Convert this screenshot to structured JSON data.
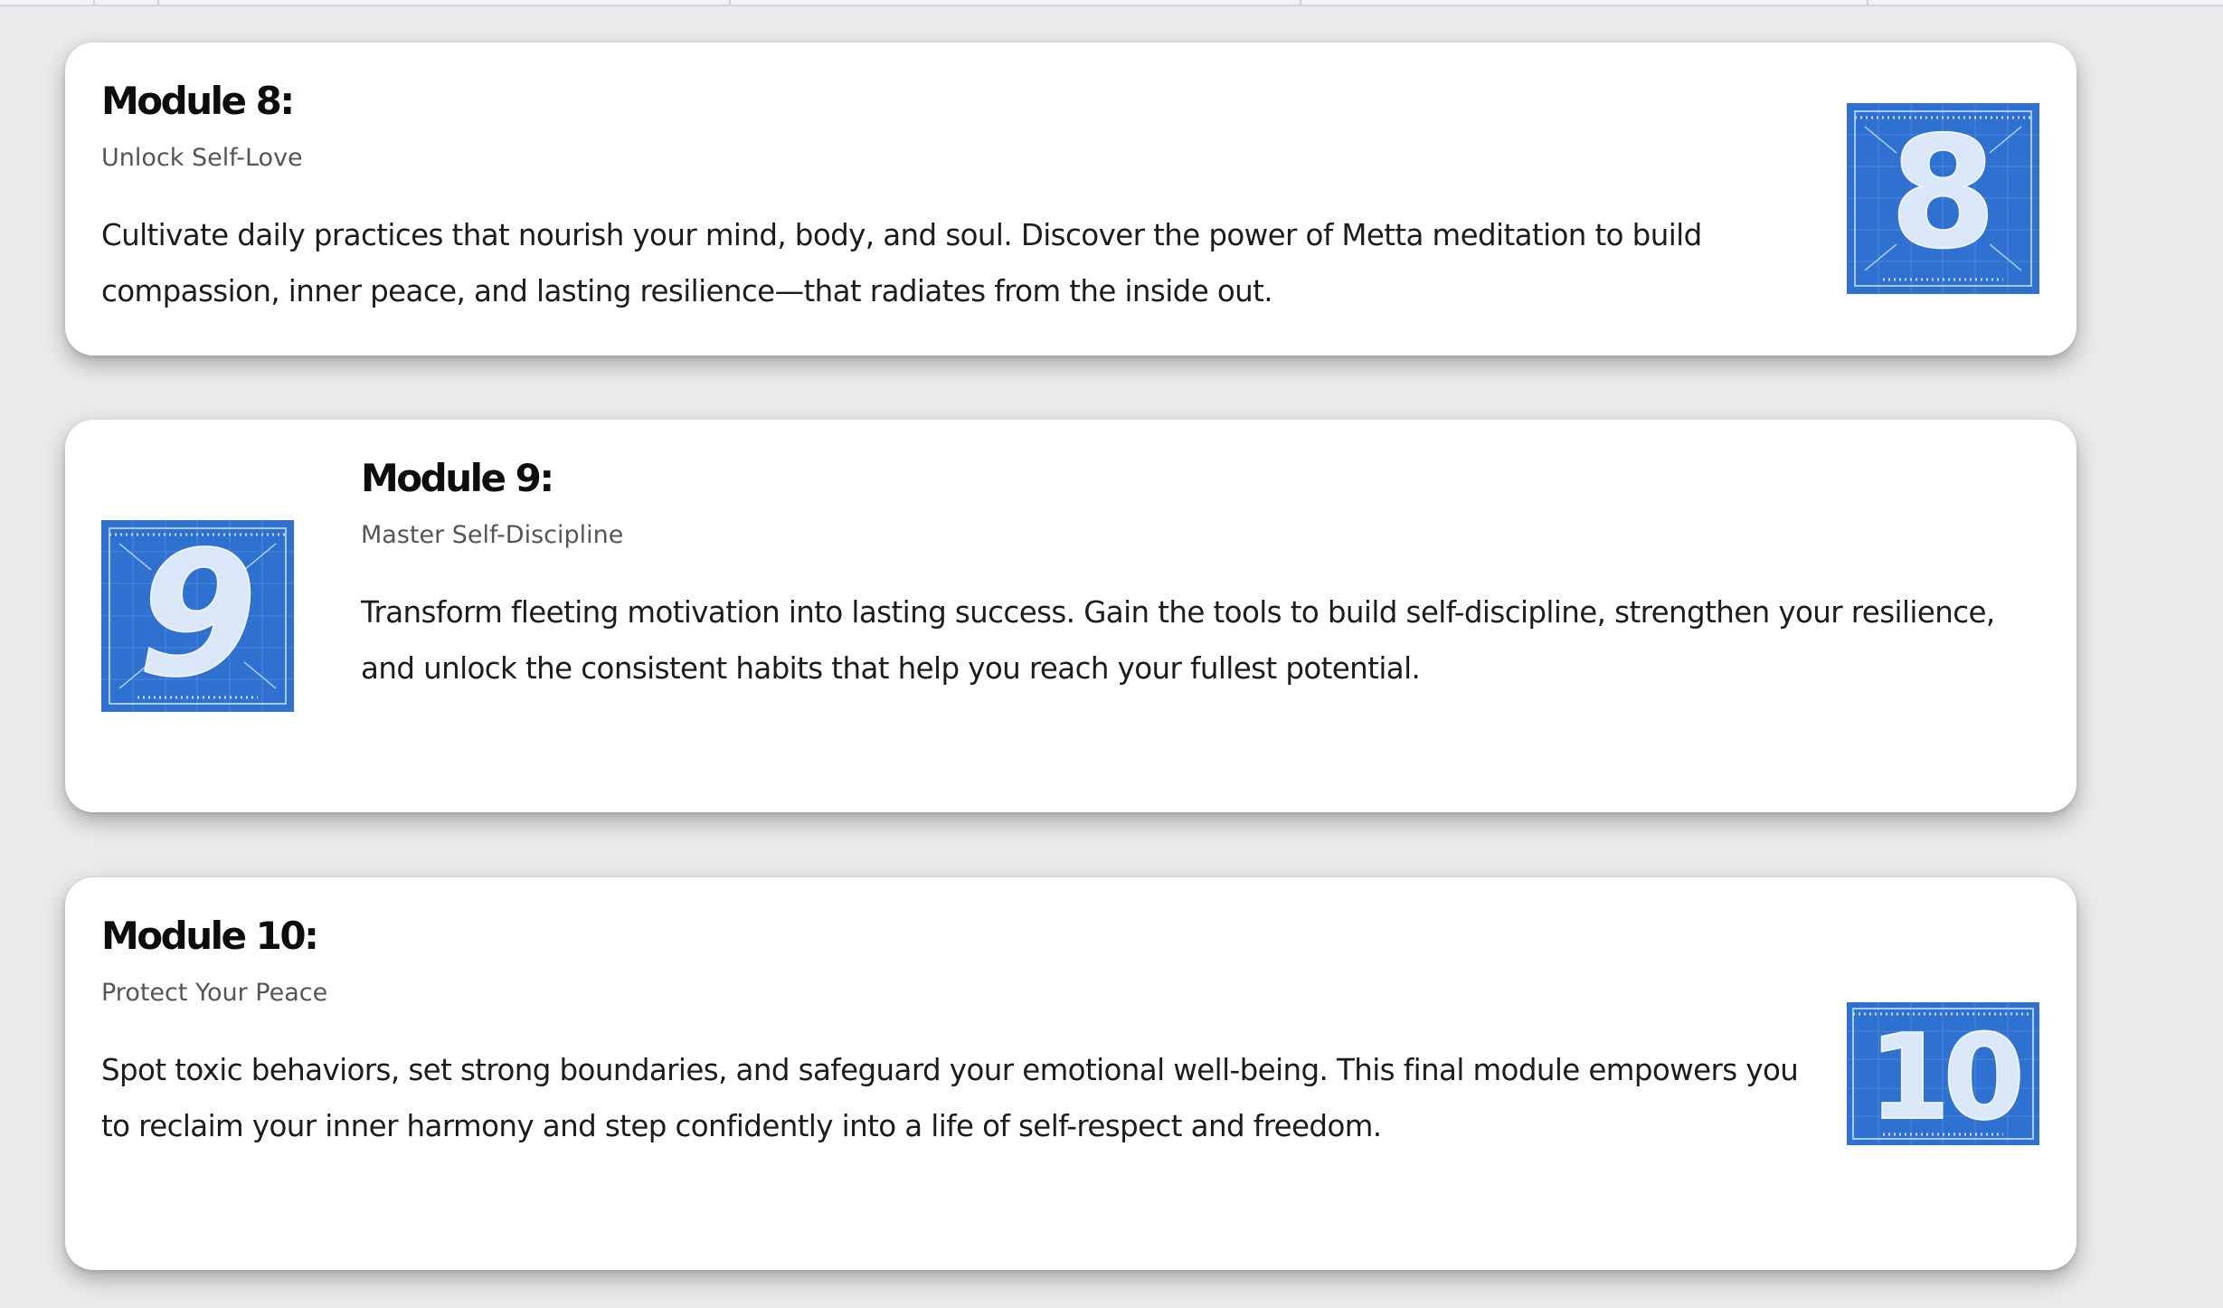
{
  "modules": [
    {
      "title": "Module 8:",
      "subtitle": "Unlock Self-Love",
      "description": "Cultivate daily practices that nourish your mind, body, and soul. Discover the power of Metta meditation to build compassion, inner peace, and lasting resilience—that radiates from the inside out.",
      "image_number": "8"
    },
    {
      "title": "Module 9:",
      "subtitle": "Master Self-Discipline",
      "description": "Transform fleeting motivation into lasting success. Gain the tools to build self-discipline, strengthen your resilience, and unlock the consistent habits that help you reach your fullest potential.",
      "image_number": "9"
    },
    {
      "title": "Module 10:",
      "subtitle": "Protect Your Peace",
      "description": "Spot toxic behaviors, set strong boundaries, and safeguard your emotional well-being. This final module empowers you to reclaim your inner harmony and step confidently into a life of self-respect and freedom.",
      "image_number": "10"
    }
  ],
  "colors": {
    "page_background": "#e9eaec",
    "card_background": "#ffffff",
    "blueprint_blue": "#2f71d0",
    "blueprint_line": "#8fb8ee"
  },
  "icons": [
    "blueprint-number-8-image",
    "blueprint-number-9-image",
    "blueprint-number-10-image"
  ]
}
